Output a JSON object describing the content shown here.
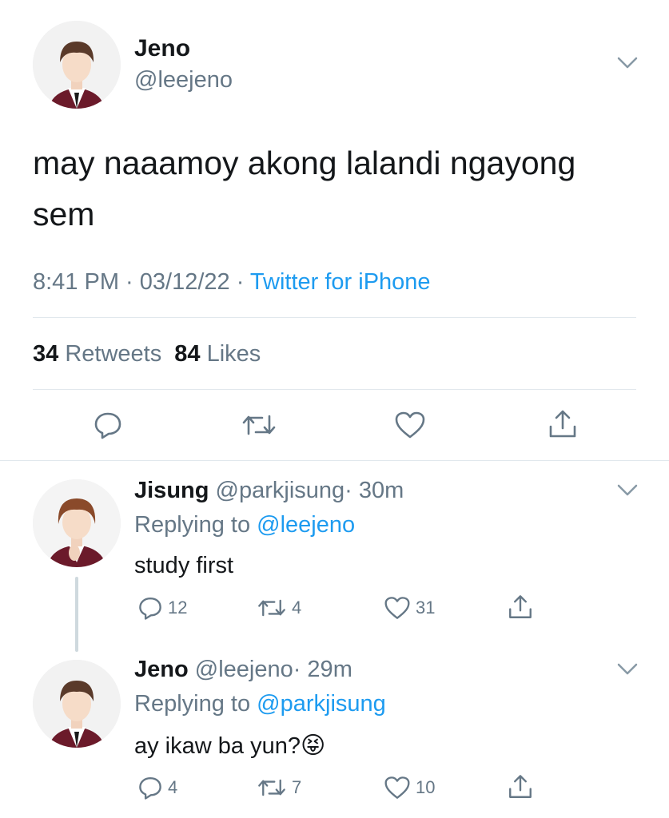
{
  "main_tweet": {
    "name": "Jeno",
    "handle": "@leejeno",
    "text": "may naaamoy akong lalandi ngayong sem",
    "time": "8:41 PM · 03/12/22 · ",
    "source": "Twitter for iPhone",
    "retweets_count": "34",
    "retweets_label": "Retweets",
    "likes_count": "84",
    "likes_label": "Likes"
  },
  "replies": [
    {
      "name": "Jisung",
      "handle": "@parkjisung",
      "time": "· 30m",
      "replying_prefix": "Replying to ",
      "replying_to": "@leejeno",
      "text": "study first",
      "reply_count": "12",
      "retweet_count": "4",
      "like_count": "31"
    },
    {
      "name": "Jeno",
      "handle": "@leejeno",
      "time": "· 29m",
      "replying_prefix": "Replying to ",
      "replying_to": "@parkjisung",
      "text": "ay ikaw ba yun?",
      "emoji": "😝",
      "reply_count": "4",
      "retweet_count": "7",
      "like_count": "10"
    }
  ],
  "colors": {
    "link": "#1d9bf0",
    "muted": "#657786",
    "divider": "#e1e8ed",
    "thread_line": "#cfd9de"
  },
  "icons": [
    "chevron-down-icon",
    "reply-icon",
    "retweet-icon",
    "like-icon",
    "share-icon"
  ]
}
